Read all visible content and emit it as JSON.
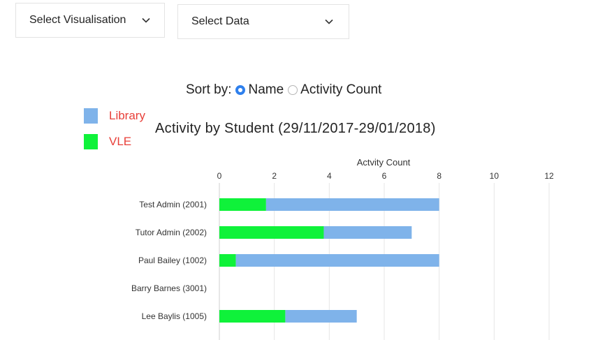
{
  "toolbar": {
    "visualisation_label": "Select Visualisation",
    "data_label": "Select Data"
  },
  "sort": {
    "label": "Sort by:",
    "options": [
      "Name",
      "Activity Count"
    ],
    "selected": "Name"
  },
  "colors": {
    "library": "#7fb3ea",
    "vle": "#0ff23a",
    "legend_text": "#e8403a",
    "radio_selected": "#2f80ed"
  },
  "chart_data": {
    "type": "bar",
    "orientation": "horizontal",
    "stacked": true,
    "title": "Activity by Student (29/11/2017-29/01/2018)",
    "xlabel": "Actvity Count",
    "xlim": [
      0,
      12
    ],
    "xticks": [
      0,
      2,
      4,
      6,
      8,
      10,
      12
    ],
    "grid": true,
    "legend": "top-left",
    "categories": [
      "Test Admin (2001)",
      "Tutor Admin (2002)",
      "Paul Bailey (1002)",
      "Barry Barnes (3001)",
      "Lee Baylis (1005)"
    ],
    "series": [
      {
        "name": "VLE",
        "values": [
          1.7,
          3.8,
          0.6,
          0,
          2.4
        ]
      },
      {
        "name": "Library",
        "values": [
          6.3,
          3.2,
          7.4,
          0,
          2.6
        ]
      }
    ]
  }
}
